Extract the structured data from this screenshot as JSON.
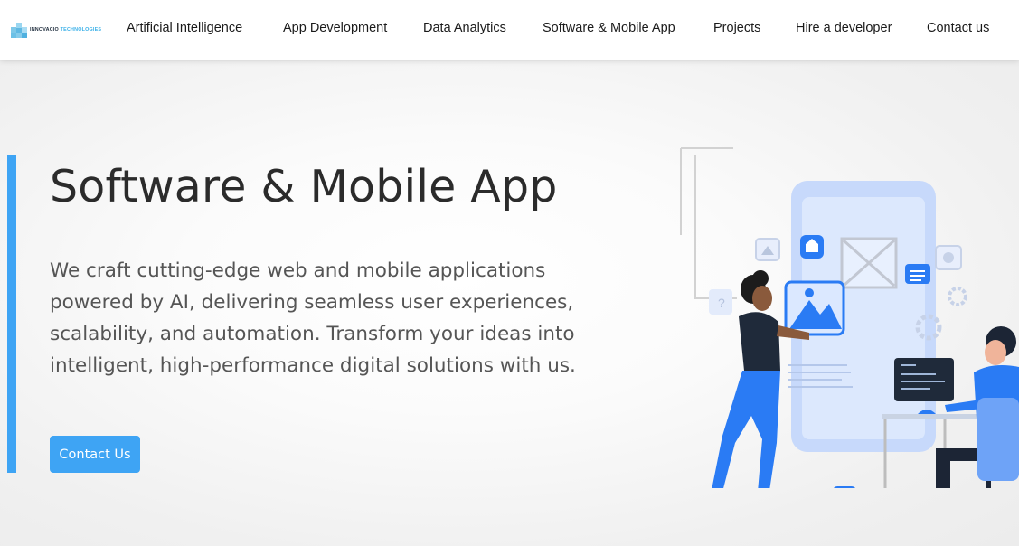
{
  "brand": {
    "logo_text_primary": "INNOVACIO",
    "logo_text_secondary": "TECHNOLOGIES",
    "logo_icon": "blocks-logo-icon"
  },
  "nav": {
    "items": [
      {
        "label": "Artificial Intelligence"
      },
      {
        "label": "App Development"
      },
      {
        "label": "Data Analytics"
      },
      {
        "label": "Software & Mobile App"
      },
      {
        "label": "Projects"
      },
      {
        "label": "Hire a developer"
      },
      {
        "label": "Contact us"
      }
    ]
  },
  "hero": {
    "title": "Software & Mobile App",
    "description": "We craft cutting-edge web and mobile applications powered by AI, delivering seamless user experiences, scalability, and automation. Transform your ideas into intelligent, high-performance digital solutions with us.",
    "cta_label": "Contact Us",
    "illustration": "app-development-illustration"
  },
  "colors": {
    "accent": "#3ea4f4",
    "title": "#2b2b2b",
    "body_text": "#555555",
    "nav_text": "#1a1a1a",
    "illustration_blue": "#2a7bf4",
    "illustration_light": "#c7d9fb"
  }
}
